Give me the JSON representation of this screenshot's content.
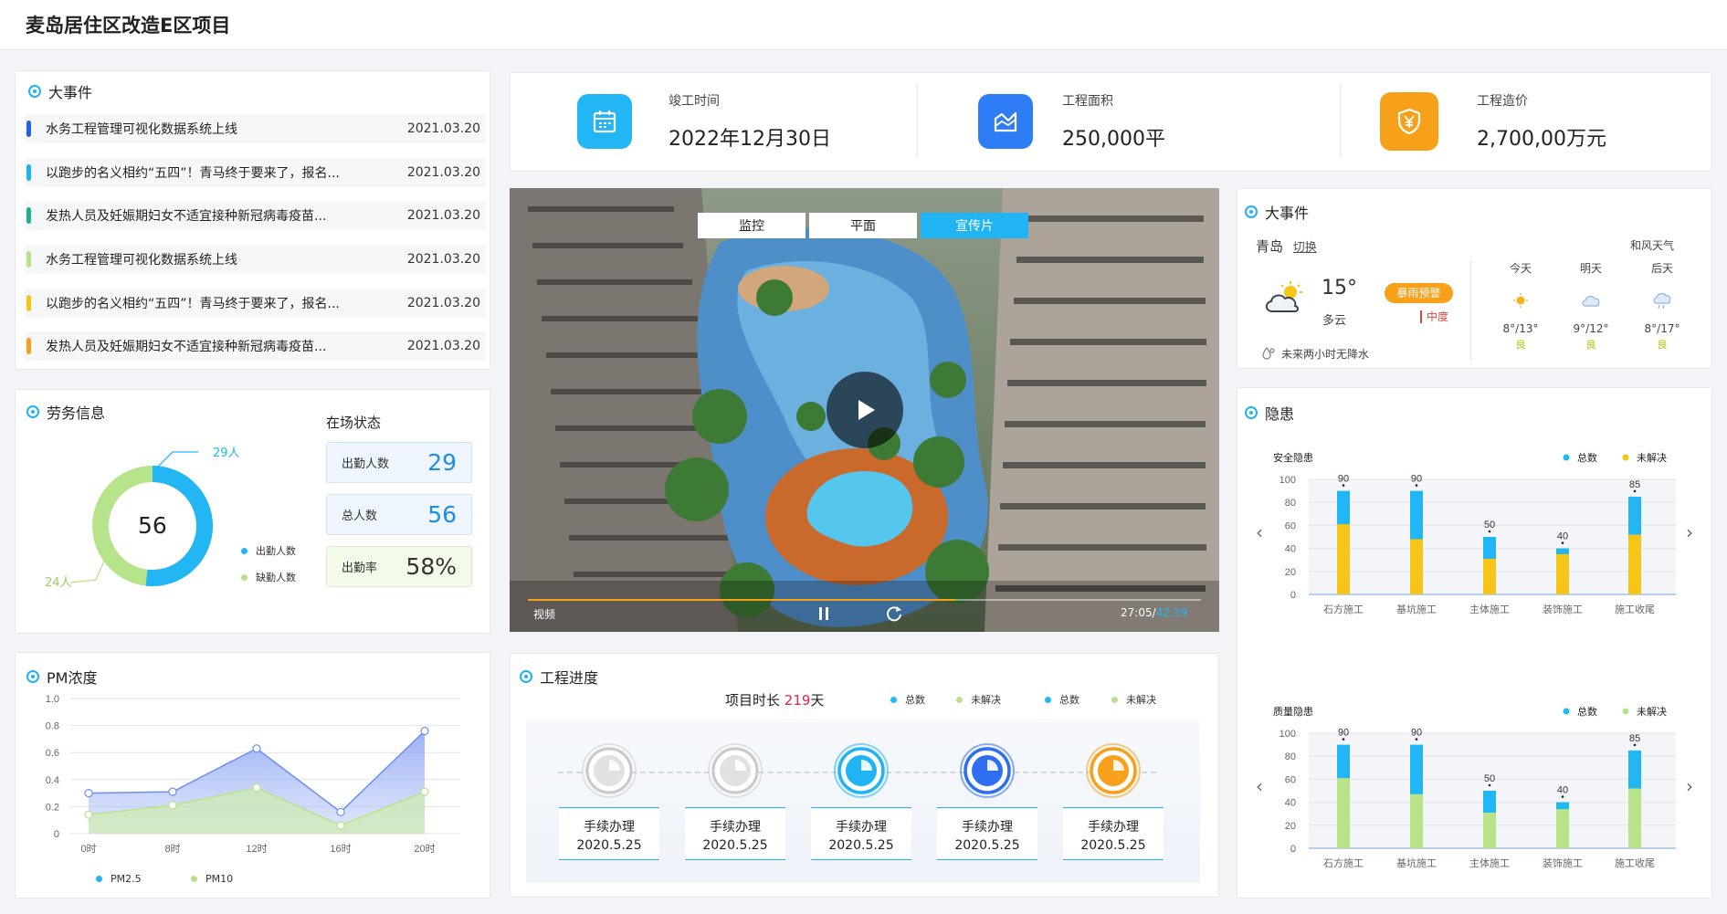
{
  "header": {
    "title": "麦岛居住区改造E区项目"
  },
  "events": {
    "title": "大事件",
    "items": [
      {
        "text": "水务工程管理可视化数据系统上线",
        "date": "2021.03.20",
        "color": "#1e63f0"
      },
      {
        "text": "以跑步的名义相约“五四”！青马终于要来了，报名...",
        "date": "2021.03.20",
        "color": "#21b4f5"
      },
      {
        "text": "发热人员及妊娠期妇女不适宜接种新冠病毒疫苗...",
        "date": "2021.03.20",
        "color": "#1fb38c"
      },
      {
        "text": "水务工程管理可视化数据系统上线",
        "date": "2021.03.20",
        "color": "#b7e38a"
      },
      {
        "text": "以跑步的名义相约“五四”！青马终于要来了，报名...",
        "date": "2021.03.20",
        "color": "#f5c518"
      },
      {
        "text": "发热人员及妊娠期妇女不适宜接种新冠病毒疫苗...",
        "date": "2021.03.20",
        "color": "#f7a11a"
      }
    ]
  },
  "stats": [
    {
      "label": "竣工时间",
      "value": "2022年12月30日",
      "icon": "calendar-icon",
      "color": "#22b6f5"
    },
    {
      "label": "工程面积",
      "value": "250,000平",
      "icon": "area-chart-icon",
      "color": "#2e7cf6"
    },
    {
      "label": "工程造价",
      "value": "2,700,00万元",
      "icon": "yuan-shield-icon",
      "color": "#f7a11a"
    }
  ],
  "video": {
    "tabs": [
      "监控",
      "平面",
      "宣传片"
    ],
    "active_tab": 2,
    "label": "视频",
    "current_time": "27:05",
    "total_time": "42:39",
    "progress": 0.635
  },
  "weather": {
    "title": "大事件",
    "city": "青岛",
    "switch_label": "切换",
    "temp": "15°",
    "desc": "多云",
    "alert": "暴雨预警",
    "alert_level": "中度",
    "forecast_note": "未来两小时无降水",
    "source": "和风天气",
    "days": [
      {
        "name": "今天",
        "range": "8°/13°",
        "quality": "良",
        "icon": "sun-icon"
      },
      {
        "name": "明天",
        "range": "9°/12°",
        "quality": "良",
        "icon": "cloud-icon"
      },
      {
        "name": "后天",
        "range": "8°/17°",
        "quality": "良",
        "icon": "rain-cloud-icon"
      }
    ]
  },
  "labor": {
    "title": "劳务信息",
    "total": "56",
    "present_label": "29人",
    "absent_label": "24人",
    "legend": [
      "出勤人数",
      "缺勤人数"
    ],
    "status_title": "在场状态",
    "boxes": [
      {
        "label": "出勤人数",
        "value": "29"
      },
      {
        "label": "总人数",
        "value": "56"
      },
      {
        "label": "出勤率",
        "value": "58%"
      }
    ],
    "colors": {
      "present": "#22b6f5",
      "absent": "#b7e38a"
    }
  },
  "pm": {
    "title": "PM浓度",
    "legend": [
      "PM2.5",
      "PM10"
    ]
  },
  "progress": {
    "title": "工程进度",
    "duration_prefix": "项目时长 ",
    "duration_value": "219",
    "duration_suffix": "天",
    "legend": [
      "总数",
      "未解决",
      "总数",
      "未解决"
    ],
    "steps": [
      {
        "label": "手续办理",
        "date": "2020.5.25",
        "color": "#c9c9c9"
      },
      {
        "label": "手续办理",
        "date": "2020.5.25",
        "color": "#c9c9c9"
      },
      {
        "label": "手续办理",
        "date": "2020.5.25",
        "color": "#21b4f5"
      },
      {
        "label": "手续办理",
        "date": "2020.5.25",
        "color": "#2e6ef0"
      },
      {
        "label": "手续办理",
        "date": "2020.5.25",
        "color": "#f7a11a"
      }
    ]
  },
  "hazard": {
    "title": "隐患",
    "legend_total": "总数",
    "legend_unsolved": "未解决"
  },
  "chart_data": [
    {
      "type": "area",
      "title": "",
      "x": [
        "0时",
        "8时",
        "12时",
        "16时",
        "20时"
      ],
      "ylim": [
        0,
        1.0
      ],
      "yticks": [
        "0",
        "0.2",
        "0.4",
        "0.6",
        "0.8",
        "1.0"
      ],
      "series": [
        {
          "name": "PM2.5",
          "values": [
            0.3,
            0.31,
            0.63,
            0.16,
            0.76
          ],
          "color": "#6d8ff0"
        },
        {
          "name": "PM10",
          "values": [
            0.14,
            0.21,
            0.34,
            0.06,
            0.31
          ],
          "color": "#b7e38a"
        }
      ],
      "legend": "bottom"
    },
    {
      "type": "bar",
      "title": "安全隐患",
      "categories": [
        "石方施工",
        "基坑施工",
        "主体施工",
        "装饰施工",
        "施工收尾"
      ],
      "ylim": [
        0,
        100
      ],
      "yticks": [
        "0",
        "20",
        "40",
        "60",
        "80",
        "100"
      ],
      "series": [
        {
          "name": "总数",
          "values": [
            90,
            90,
            50,
            40,
            85
          ],
          "color": "#22b6f5"
        },
        {
          "name": "未解决",
          "values": [
            61,
            48,
            31,
            35,
            52
          ],
          "color": "#f5c518"
        }
      ],
      "labels": [
        "90",
        "90",
        "50",
        "40",
        "85"
      ],
      "legend": "top-right"
    },
    {
      "type": "bar",
      "title": "质量隐患",
      "categories": [
        "石方施工",
        "基坑施工",
        "主体施工",
        "装饰施工",
        "施工收尾"
      ],
      "ylim": [
        0,
        100
      ],
      "yticks": [
        "0",
        "20",
        "40",
        "60",
        "80",
        "100"
      ],
      "series": [
        {
          "name": "总数",
          "values": [
            90,
            90,
            50,
            40,
            85
          ],
          "color": "#22b6f5"
        },
        {
          "name": "未解决",
          "values": [
            61,
            47,
            31,
            34,
            52
          ],
          "color": "#b7e38a"
        }
      ],
      "labels": [
        "90",
        "90",
        "50",
        "40",
        "85"
      ],
      "legend": "top-right"
    }
  ]
}
